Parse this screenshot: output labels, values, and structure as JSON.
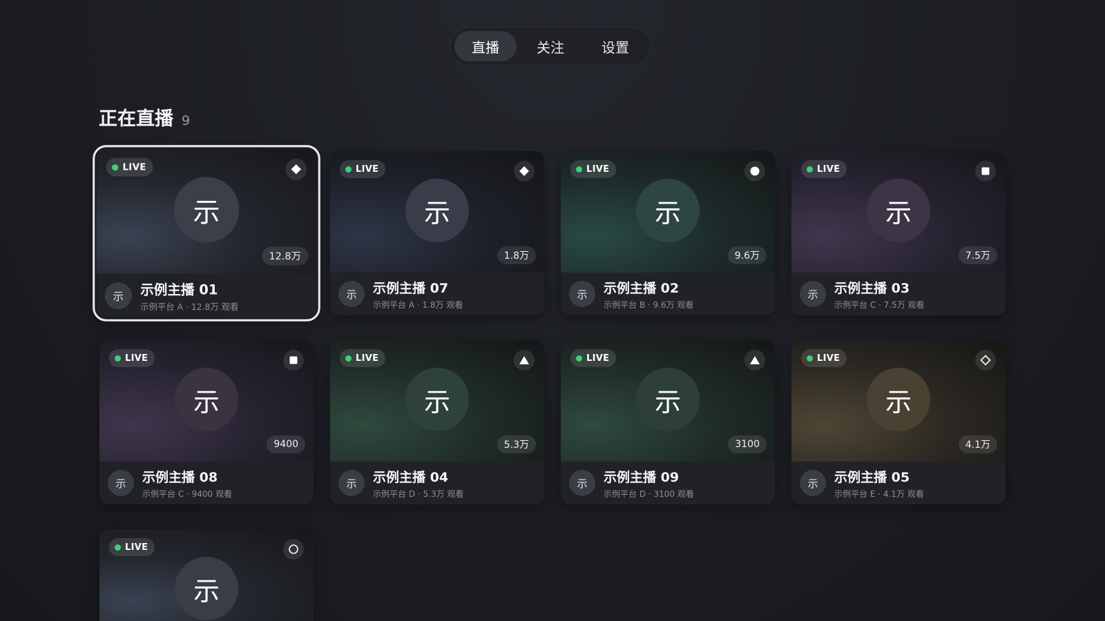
{
  "tabs": [
    {
      "label": "直播",
      "active": true
    },
    {
      "label": "关注",
      "active": false
    },
    {
      "label": "设置",
      "active": false
    }
  ],
  "section": {
    "title": "正在直播",
    "count": "9"
  },
  "live_label": "LIVE",
  "avatar_char": "示",
  "colors": {
    "live_dot": "#3fcf7a",
    "focus_outline": "#e9eaee",
    "background": "#1b1d22"
  },
  "cards": [
    {
      "name": "示例主播 01",
      "subtitle": "示例平台 A · 12.8万 观看",
      "viewers": "12.8万",
      "icon": "diamond-filled-icon",
      "theme": "slate",
      "avatar_color": "#3a3f4a",
      "focused": true
    },
    {
      "name": "示例主播 07",
      "subtitle": "示例平台 A · 1.8万 观看",
      "viewers": "1.8万",
      "icon": "diamond-filled-icon",
      "theme": "navy",
      "avatar_color": "#383d49"
    },
    {
      "name": "示例主播 02",
      "subtitle": "示例平台 B · 9.6万 观看",
      "viewers": "9.6万",
      "icon": "circle-filled-icon",
      "theme": "teal",
      "avatar_color": "#2d4641"
    },
    {
      "name": "示例主播 03",
      "subtitle": "示例平台 C · 7.5万 观看",
      "viewers": "7.5万",
      "icon": "square-filled-icon",
      "theme": "purple",
      "avatar_color": "#3d3546"
    },
    {
      "name": "示例主播 08",
      "subtitle": "示例平台 C · 9400 观看",
      "viewers": "9400",
      "icon": "square-filled-icon",
      "theme": "purple",
      "avatar_color": "#3a3342"
    },
    {
      "name": "示例主播 04",
      "subtitle": "示例平台 D · 5.3万 观看",
      "viewers": "5.3万",
      "icon": "triangle-filled-icon",
      "theme": "green",
      "avatar_color": "#2e4239"
    },
    {
      "name": "示例主播 09",
      "subtitle": "示例平台 D · 3100 观看",
      "viewers": "3100",
      "icon": "triangle-filled-icon",
      "theme": "green",
      "avatar_color": "#2d3f38"
    },
    {
      "name": "示例主播 05",
      "subtitle": "示例平台 E · 4.1万 观看",
      "viewers": "4.1万",
      "icon": "diamond-outline-icon",
      "theme": "tan",
      "avatar_color": "#4a4133"
    },
    {
      "name": "",
      "subtitle": "",
      "viewers": "",
      "icon": "circle-outline-icon",
      "theme": "slate",
      "avatar_color": "#393d46",
      "partial": true
    }
  ]
}
